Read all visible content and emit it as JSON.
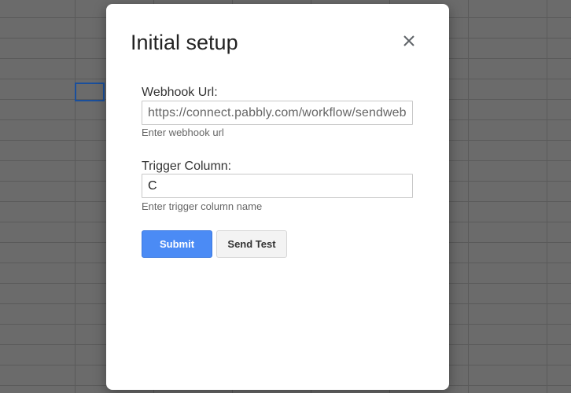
{
  "dialog": {
    "title": "Initial setup",
    "close_icon": "close-icon"
  },
  "webhook": {
    "label": "Webhook Url:",
    "value": "https://connect.pabbly.com/workflow/sendwebhookdata/",
    "helper": "Enter webhook url"
  },
  "trigger": {
    "label": "Trigger Column:",
    "value": "C",
    "helper": "Enter trigger column name"
  },
  "buttons": {
    "submit_label": "Submit",
    "send_test_label": "Send Test"
  },
  "colors": {
    "submit_bg": "#4b8bf5",
    "annotation_arrow": "#e8141b",
    "backdrop": "#6b6b6b"
  },
  "annotation": {
    "arrow_icon": "arrow-right-icon"
  }
}
